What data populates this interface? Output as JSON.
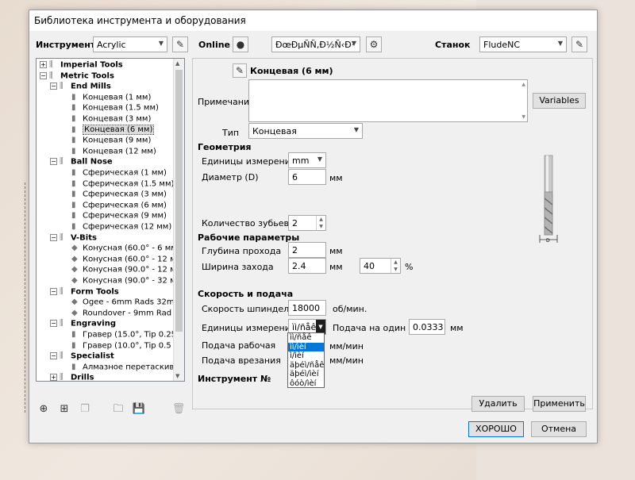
{
  "window": {
    "title": "Библиотека инструмента и оборудования"
  },
  "top": {
    "tool_label": "Инструмент",
    "tool_value": "Acrylic",
    "online_label": "Online",
    "online_combo": "ÐœÐµÑÑ‚Ð½Ñ‹Ð¹",
    "machine_label": "Станок",
    "machine_value": "FludeNC"
  },
  "tree": [
    {
      "label": "Imperial Tools",
      "level": 0,
      "bold": true,
      "exp": "+"
    },
    {
      "label": "Metric Tools",
      "level": 0,
      "bold": true,
      "exp": "−"
    },
    {
      "label": "End Mills",
      "level": 1,
      "bold": true,
      "exp": "−"
    },
    {
      "label": "Концевая (1 мм)",
      "level": 2
    },
    {
      "label": "Концевая (1.5 мм)",
      "level": 2
    },
    {
      "label": "Концевая (3 мм)",
      "level": 2
    },
    {
      "label": "Концевая (6 мм)",
      "level": 2,
      "selected": true
    },
    {
      "label": "Концевая (9 мм)",
      "level": 2
    },
    {
      "label": "Концевая (12 мм)",
      "level": 2
    },
    {
      "label": "Ball Nose",
      "level": 1,
      "bold": true,
      "exp": "−"
    },
    {
      "label": "Сферическая (1 мм)",
      "level": 2
    },
    {
      "label": "Сферическая (1.5 мм)",
      "level": 2
    },
    {
      "label": "Сферическая (3 мм)",
      "level": 2
    },
    {
      "label": "Сферическая (6 мм)",
      "level": 2
    },
    {
      "label": "Сферическая (9 мм)",
      "level": 2
    },
    {
      "label": "Сферическая (12 мм)",
      "level": 2
    },
    {
      "label": "V-Bits",
      "level": 1,
      "bold": true,
      "exp": "−"
    },
    {
      "label": "Конусная (60.0° - 6 мм)",
      "level": 2,
      "vbit": true
    },
    {
      "label": "Конусная (60.0° - 12 мм)",
      "level": 2,
      "vbit": true
    },
    {
      "label": "Конусная (90.0° - 12 мм)",
      "level": 2,
      "vbit": true
    },
    {
      "label": "Конусная (90.0° - 32 мм)",
      "level": 2,
      "vbit": true
    },
    {
      "label": "Form Tools",
      "level": 1,
      "bold": true,
      "exp": "−"
    },
    {
      "label": "Ogee - 6mm Rads 32mm D",
      "level": 2,
      "vbit": true
    },
    {
      "label": "Roundover - 9mm Rad 25",
      "level": 2,
      "vbit": true
    },
    {
      "label": "Engraving",
      "level": 1,
      "bold": true,
      "exp": "−"
    },
    {
      "label": "Гравер (15.0°, Tip 0.25 -",
      "level": 2
    },
    {
      "label": "Гравер (10.0°, Tip 0.5 - 6",
      "level": 2
    },
    {
      "label": "Specialist",
      "level": 1,
      "bold": true,
      "exp": "−"
    },
    {
      "label": "Алмазное перетаскиван",
      "level": 2
    },
    {
      "label": "Drills",
      "level": 1,
      "bold": true,
      "exp": "+"
    }
  ],
  "form": {
    "tool_name": "Концевая (6 мм)",
    "note_label": "Примечание",
    "variables_btn": "Variables",
    "type_label": "Тип",
    "type_value": "Концевая",
    "geometry_heading": "Геометрия",
    "units_label": "Единицы измерения",
    "units_value": "mm",
    "diameter_label": "Диаметр (D)",
    "diameter_value": "6",
    "diameter_unit": "мм",
    "flutes_label": "Количество зубьев",
    "flutes_value": "2",
    "params_heading": "Рабочие параметры",
    "pass_depth_label": "Глубина прохода",
    "pass_depth_value": "2",
    "pass_depth_unit": "мм",
    "stepover_label": "Ширина захода",
    "stepover_value": "2.4",
    "stepover_unit": "мм",
    "stepover_pct": "40",
    "stepover_pct_unit": "%",
    "speed_heading": "Скорость и подача",
    "spindle_label": "Скорость шпинделя",
    "spindle_value": "18000",
    "spindle_unit": "об/мин.",
    "feed_units_label": "Единицы измерения",
    "feed_units_value": "ìì/ñåê",
    "per_tooth_label": "Подача на один зуб",
    "per_tooth_value": "0.0333",
    "per_tooth_unit": "мм",
    "feed_label": "Подача рабочая",
    "feed_unit": "мм/мин",
    "plunge_label": "Подача врезания",
    "plunge_unit": "мм/мин",
    "tool_no_label": "Инструмент №",
    "dropdown_options": [
      "ìì/ñåê",
      "ìì/ìèí",
      "ì/ìèí",
      "äþéì/ñåê",
      "äþéì/ìèí",
      "ôóò/ìèí"
    ],
    "diagram_label": "D"
  },
  "buttons": {
    "delete": "Удалить",
    "apply": "Применить",
    "ok": "ХОРОШО",
    "cancel": "Отмена"
  }
}
